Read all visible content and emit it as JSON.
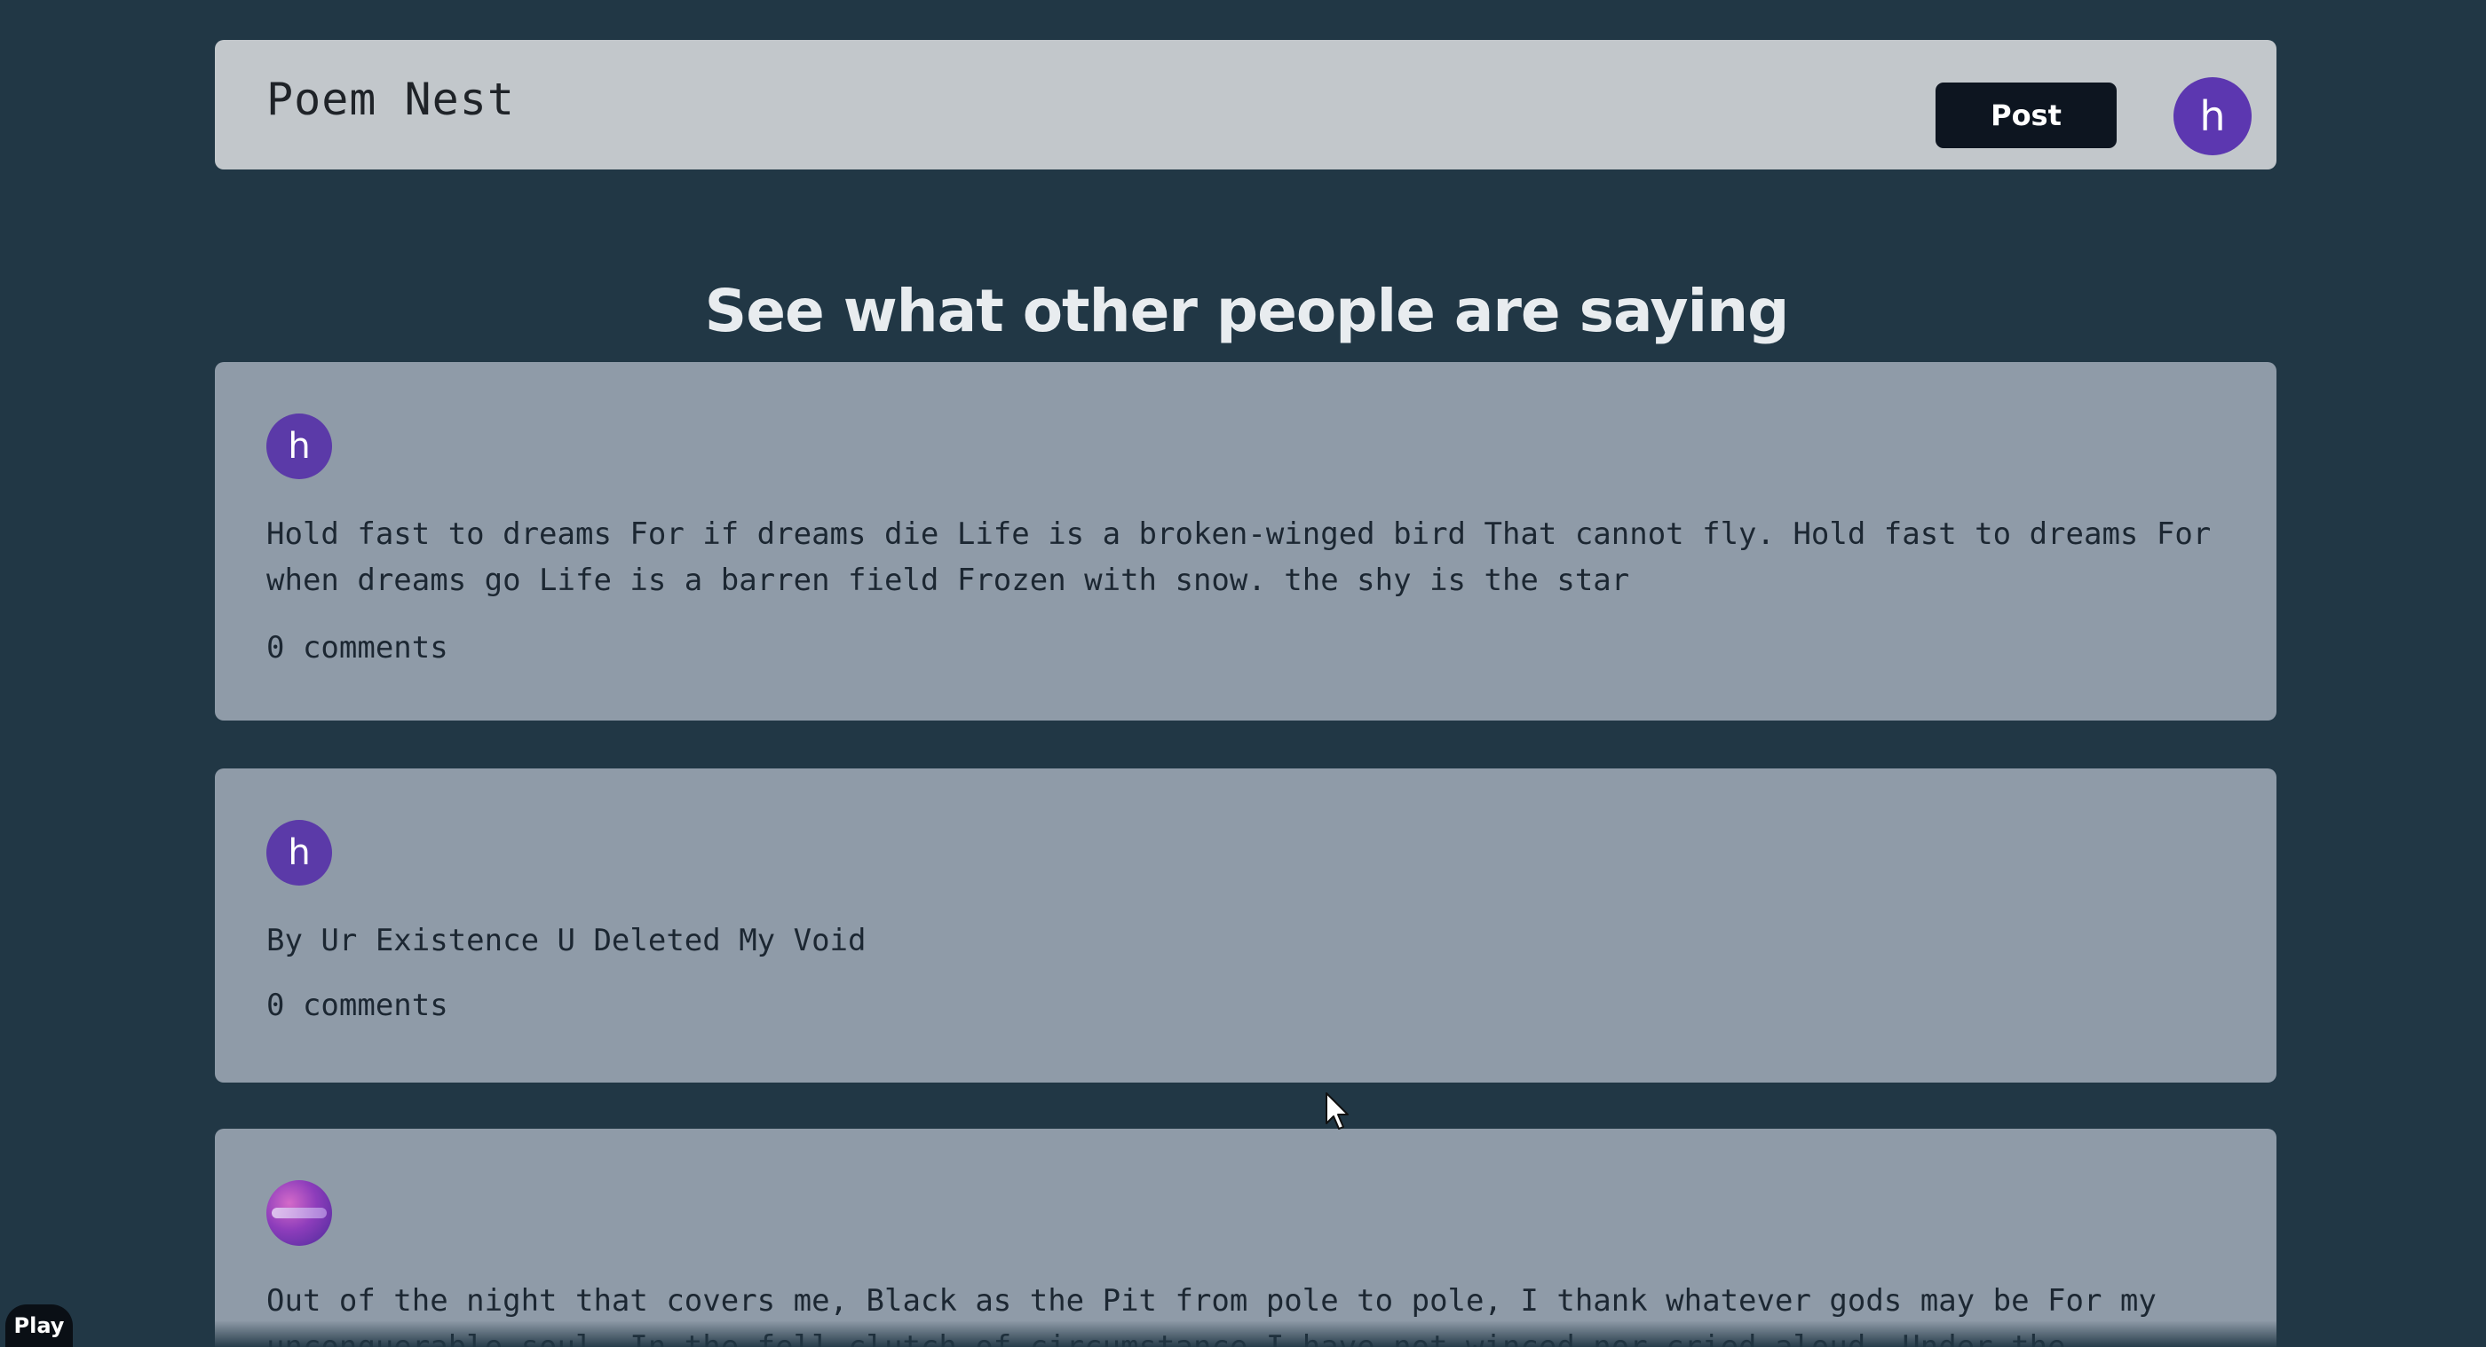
{
  "header": {
    "brand": "Poem Nest",
    "post_label": "Post",
    "user_initial": "h"
  },
  "heading": "See what other people are saying",
  "posts": [
    {
      "author_initial": "h",
      "text": "Hold fast to dreams For if dreams die Life is a broken-winged bird That cannot fly. Hold fast to dreams For when dreams go Life is a barren field Frozen with snow. the shy is the star",
      "comments": "0 comments"
    },
    {
      "author_initial": "h",
      "text": "By Ur Existence U Deleted My Void",
      "comments": "0 comments"
    },
    {
      "avatar_icon": "profile-image-avatar",
      "text": "Out of the night that covers me, Black as the Pit from pole to pole, I thank whatever gods may be For my unconquerable soul. In the fell clutch of circumstance I have not winced nor cried aloud. Under the"
    }
  ],
  "overlay": {
    "play_label": "Play"
  },
  "colors": {
    "background": "#213745",
    "header_bg": "#c2c7cb",
    "card_bg": "#8f9ba8",
    "avatar_purple": "#5b3aa8",
    "button_bg": "#0d1520"
  }
}
